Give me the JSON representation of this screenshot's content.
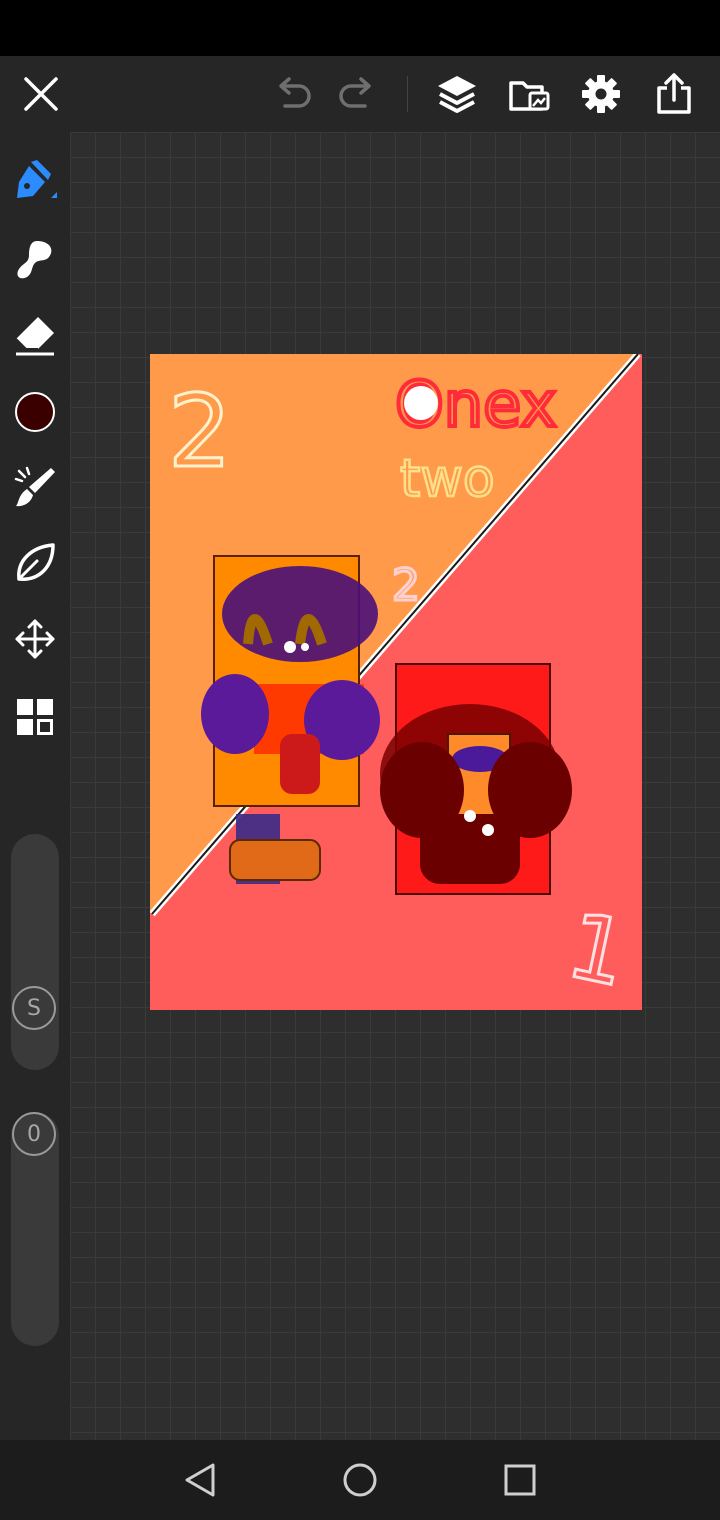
{
  "app": {
    "accent_color": "#2a8cff"
  },
  "toolbar": {
    "icons": [
      "close-icon",
      "undo-icon",
      "redo-icon",
      "layers-icon",
      "gallery-icon",
      "settings-icon",
      "share-icon"
    ]
  },
  "tools": {
    "icons": [
      "pen-icon",
      "smudge-icon",
      "eraser-icon",
      "color-swatch",
      "brush-icon",
      "leaf-icon",
      "move-icon",
      "grid-icon"
    ],
    "current_color": "#3a0000"
  },
  "sliders": {
    "size_label": "S",
    "opacity_label": "0"
  },
  "artwork": {
    "text_top_left": "2",
    "text_top_right_line1": "Onex",
    "text_top_right_line2": "two",
    "text_mid": "2",
    "text_bottom_right": "1",
    "background_left": "#ff9a4a",
    "background_right": "#ff5c5c"
  },
  "navigation": {
    "icons": [
      "back-icon",
      "home-icon",
      "recents-icon"
    ]
  }
}
